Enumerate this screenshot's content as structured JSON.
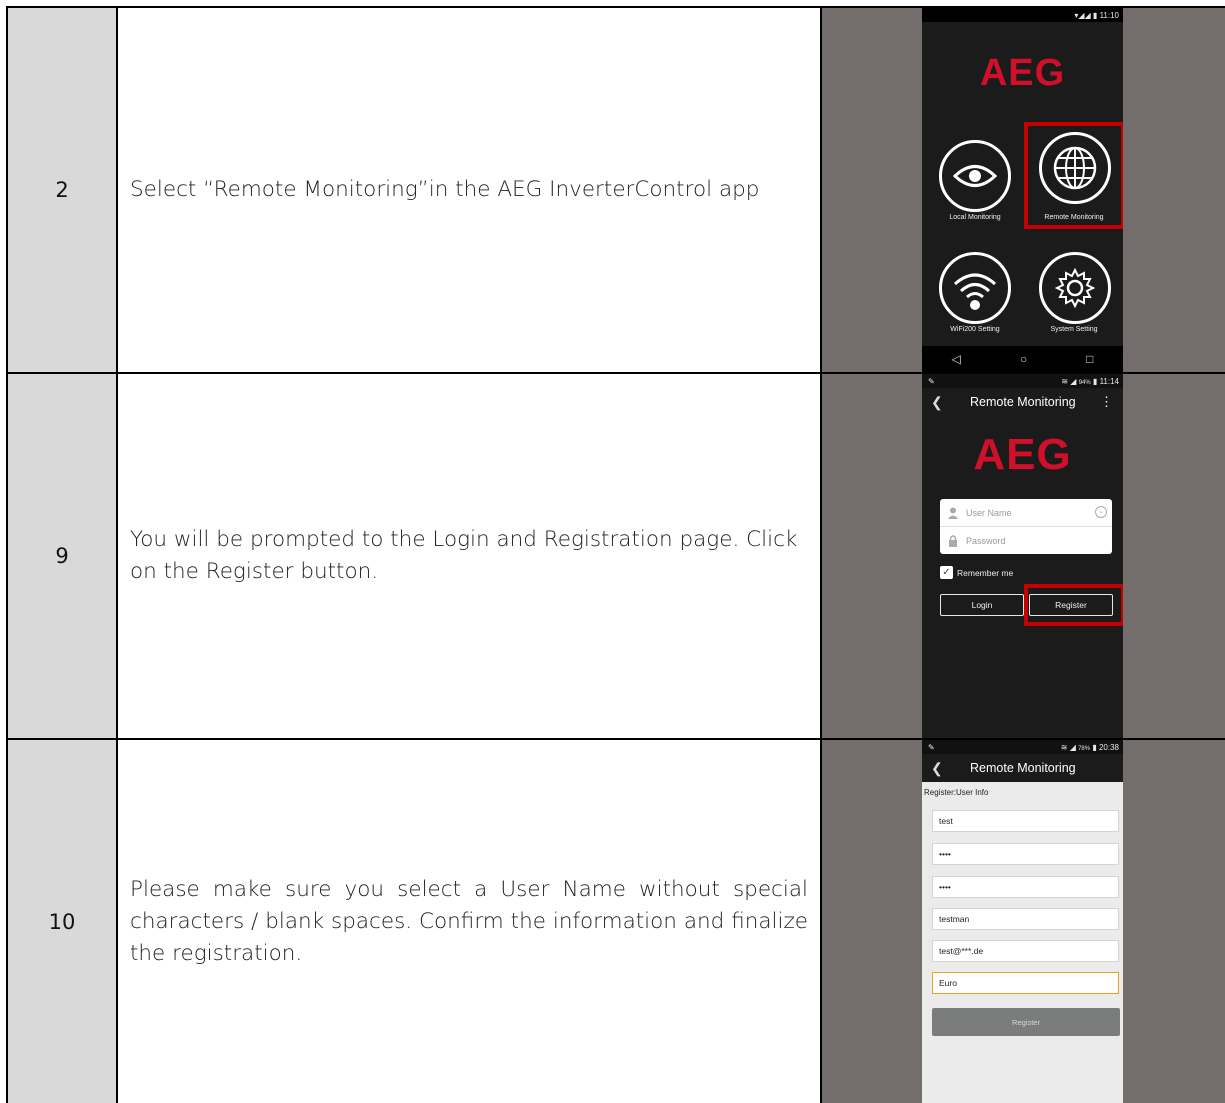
{
  "rows": [
    {
      "step": "2",
      "text": "Select “Remote Monitoring”in the AEG InverterControl app",
      "screen": {
        "status_time": "11:10",
        "logo": "AEG",
        "tiles": [
          {
            "label": "Local Monitoring",
            "icon": "eye-icon"
          },
          {
            "label": "Remote Monitoring",
            "icon": "globe-icon"
          },
          {
            "label": "WiFi200 Setting",
            "icon": "wifi-icon"
          },
          {
            "label": "System Setting",
            "icon": "gear-icon"
          }
        ],
        "nav": [
          "◁",
          "○",
          "□"
        ]
      }
    },
    {
      "step": "9",
      "text": "You will be prompted to the Login and Registration page. Click on the Register button.",
      "screen": {
        "status_time": "11:14",
        "status_battery": "94%",
        "title": "Remote Monitoring",
        "logo": "AEG",
        "username_placeholder": "User Name",
        "password_placeholder": "Password",
        "remember": "Remember me",
        "login_label": "Login",
        "register_label": "Register"
      }
    },
    {
      "step": "10",
      "text": "Please make sure you select a User Name without special characters / blank spaces. Confirm the information and finalize the registration.",
      "screen": {
        "status_time": "20:38",
        "status_battery": "78%",
        "title": "Remote Monitoring",
        "section_label": "Register:User Info",
        "fields": [
          "test",
          "••••",
          "••••",
          "testman",
          "test@***.de",
          "Euro"
        ],
        "register_label": "Register"
      }
    }
  ],
  "colors": {
    "accent_red": "#c40000",
    "logo_red": "#d0102a",
    "image_bg": "#736e6b",
    "step_bg": "#d9d9d9"
  }
}
